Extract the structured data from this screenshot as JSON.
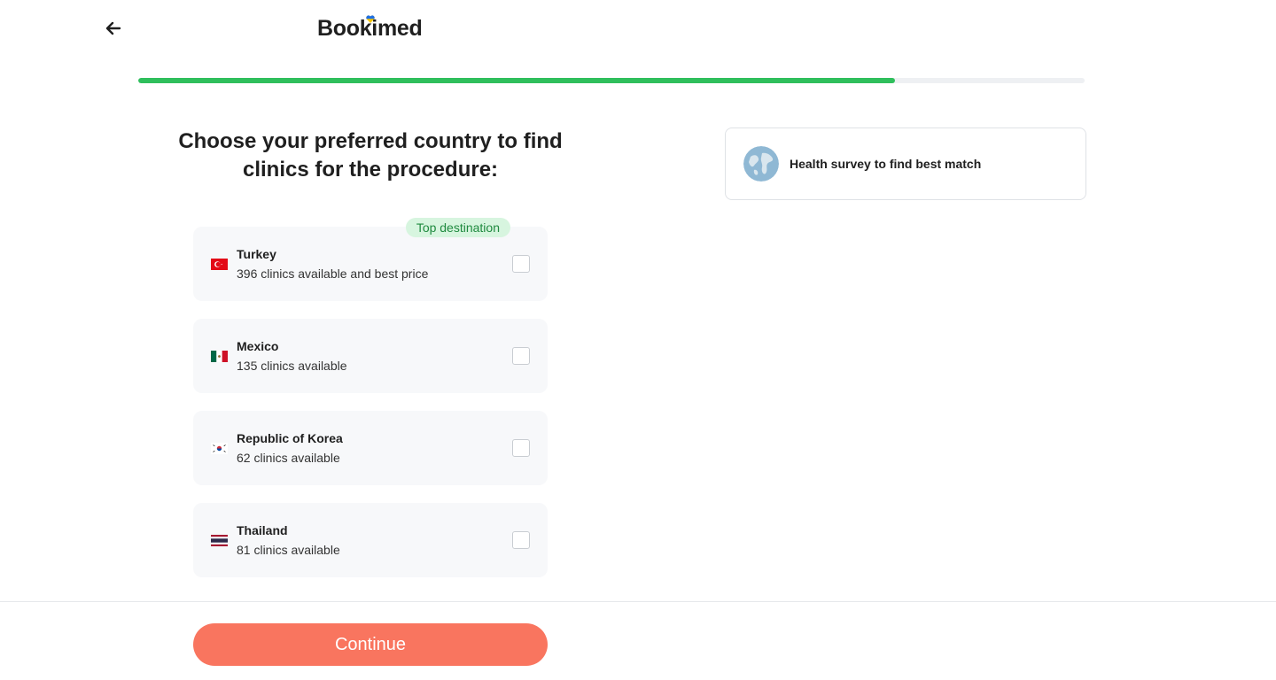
{
  "header": {
    "logo_text": "Bookimed",
    "back_icon": "arrow-left-icon"
  },
  "progress": {
    "fraction": 0.8
  },
  "main": {
    "title": "Choose your preferred country to find clinics for the procedure:"
  },
  "options": [
    {
      "country": "Turkey",
      "subtitle": "396 clinics available and best price",
      "badge": "Top destination",
      "flag_icon": "turkey-flag-icon",
      "checked": false
    },
    {
      "country": "Mexico",
      "subtitle": "135 clinics available",
      "flag_icon": "mexico-flag-icon",
      "checked": false
    },
    {
      "country": "Republic of Korea",
      "subtitle": "62 clinics available",
      "flag_icon": "korea-flag-icon",
      "checked": false
    },
    {
      "country": "Thailand",
      "subtitle": "81 clinics available",
      "flag_icon": "thailand-flag-icon",
      "checked": false
    }
  ],
  "sidebar": {
    "survey_label": "Health survey to find best match",
    "survey_icon": "globe-icon"
  },
  "footer": {
    "continue_label": "Continue"
  },
  "colors": {
    "accent": "#2fbf5c",
    "button": "#f9755f",
    "badge_bg": "#d7f5df",
    "badge_text": "#1f8a3f"
  }
}
